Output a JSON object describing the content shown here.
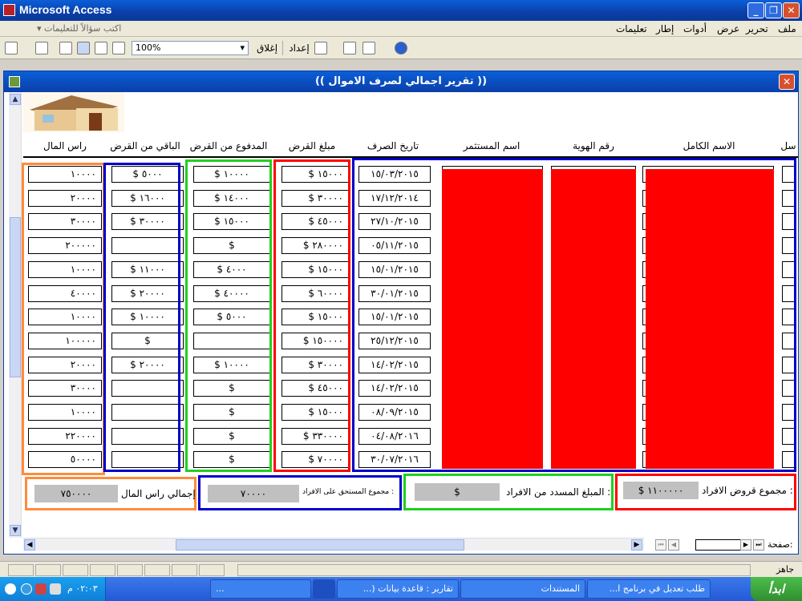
{
  "app": {
    "title": "Microsoft Access"
  },
  "menu": {
    "help_placeholder": "اكتب سؤالاً للتعليمات",
    "items": [
      "ملف",
      "تحرير",
      "عرض",
      "أدوات",
      "إطار",
      "تعليمات"
    ]
  },
  "toolbar": {
    "zoom": "100%",
    "close_label": "إغلاق",
    "setup_label": "إعداد"
  },
  "report": {
    "title": "(( تقرير اجمالي لصرف الاموال ))",
    "headers": {
      "capital": "راس المال",
      "remaining": "الباقي من القرض",
      "paid": "المدفوع من القرض",
      "loan": "مبلغ القرض",
      "date": "تاريخ الصرف",
      "investor": "اسم المستثمر",
      "id_number": "رقم الهوية",
      "full_name": "الاسم الكامل",
      "seq": "سل"
    },
    "rows": [
      {
        "capital": "١٠٠٠٠",
        "remaining": "$ ٥٠٠٠",
        "paid": "$ ١٠٠٠٠",
        "loan": "$ ١٥٠٠٠",
        "date": "١٥/٠٣/٢٠١٥"
      },
      {
        "capital": "٢٠٠٠٠",
        "remaining": "$ ١٦٠٠٠",
        "paid": "$ ١٤٠٠٠",
        "loan": "$ ٣٠٠٠٠",
        "date": "١٧/١٢/٢٠١٤"
      },
      {
        "capital": "٣٠٠٠٠",
        "remaining": "$ ٣٠٠٠٠",
        "paid": "$ ١٥٠٠٠",
        "loan": "$ ٤٥٠٠٠",
        "date": "٢٧/١٠/٢٠١٥"
      },
      {
        "capital": "٢٠٠٠٠٠",
        "remaining": "",
        "paid": "$",
        "loan": "$ ٢٨٠٠٠٠",
        "date": "٠٥/١١/٢٠١٥"
      },
      {
        "capital": "١٠٠٠٠",
        "remaining": "$ ١١٠٠٠",
        "paid": "$ ٤٠٠٠",
        "loan": "$ ١٥٠٠٠",
        "date": "١٥/٠١/٢٠١٥"
      },
      {
        "capital": "٤٠٠٠٠",
        "remaining": "$ ٢٠٠٠٠",
        "paid": "$ ٤٠٠٠٠",
        "loan": "$ ٦٠٠٠٠",
        "date": "٣٠/٠١/٢٠١٥"
      },
      {
        "capital": "١٠٠٠٠",
        "remaining": "$ ١٠٠٠٠",
        "paid": "$ ٥٠٠٠",
        "loan": "$ ١٥٠٠٠",
        "date": "١٥/٠١/٢٠١٥"
      },
      {
        "capital": "١٠٠٠٠٠",
        "remaining": "$",
        "paid": "",
        "loan": "$ ١٥٠٠٠٠",
        "date": "٢٥/١٢/٢٠١٥"
      },
      {
        "capital": "٢٠٠٠٠",
        "remaining": "$ ٢٠٠٠٠",
        "paid": "$ ١٠٠٠٠",
        "loan": "$ ٣٠٠٠٠",
        "date": "١٤/٠٢/٢٠١٥"
      },
      {
        "capital": "٣٠٠٠٠",
        "remaining": "",
        "paid": "$",
        "loan": "$ ٤٥٠٠٠",
        "date": "١٤/٠٢/٢٠١٥"
      },
      {
        "capital": "١٠٠٠٠",
        "remaining": "",
        "paid": "$",
        "loan": "$ ١٥٠٠٠",
        "date": "٠٨/٠٩/٢٠١٥"
      },
      {
        "capital": "٢٢٠٠٠٠",
        "remaining": "",
        "paid": "$",
        "loan": "$ ٣٣٠٠٠٠",
        "date": "٠٤/٠٨/٢٠١٦"
      },
      {
        "capital": "٥٠٠٠٠",
        "remaining": "",
        "paid": "$",
        "loan": "$ ٧٠٠٠٠",
        "date": "٣٠/٠٧/٢٠١٦"
      }
    ],
    "footer": {
      "capital_label": "إجمالي راس المال",
      "capital_value": "٧٥٠٠٠٠",
      "remaining_label": "مجموع المستحق على الافراد :",
      "remaining_value": "٧٠٠٠٠",
      "paid_label": "المبلغ المسدد من الافراد :",
      "paid_value": "$",
      "loans_label": "مجموع قروض الافراد :",
      "loans_value": "$ ١١٠٠٠٠٠"
    },
    "nav": {
      "page_label": "صفحة:",
      "page_value": "١"
    }
  },
  "status": {
    "text": "جاهز"
  },
  "taskbar": {
    "start_label": "ابدأ",
    "tasks": [
      "طلب تعديل في برنامج ا...",
      "المستندات",
      "تقارير : قاعدة بيانات (...",
      "...",
      ""
    ],
    "clock": "٠٢:٠٣ م"
  },
  "colors": {
    "orange": "#ff8c3c",
    "blue": "#0000c8",
    "green": "#20d020",
    "red": "#ff0000",
    "redact": "#ff0000"
  }
}
